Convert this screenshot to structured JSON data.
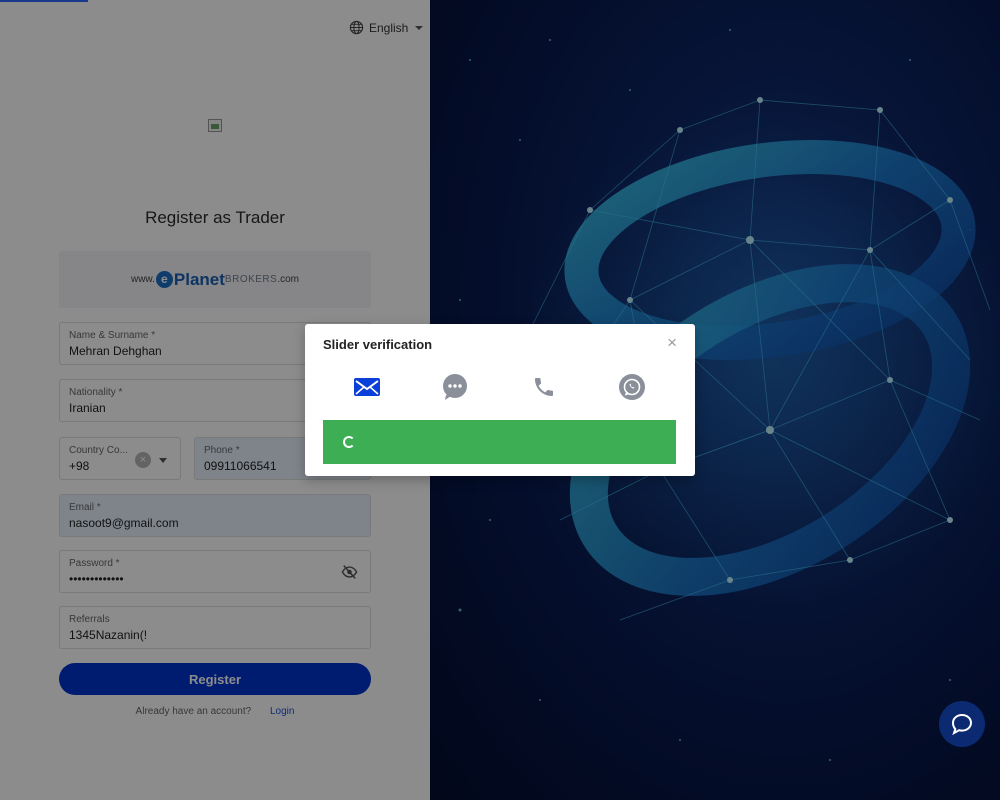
{
  "header": {
    "language": "English"
  },
  "page": {
    "title": "Register as Trader"
  },
  "brand": {
    "www": "www.",
    "letter": "e",
    "name": "Planet",
    "suffix": "BROKERS",
    "tld": ".com"
  },
  "form": {
    "name": {
      "label": "Name & Surname *",
      "value": "Mehran Dehghan"
    },
    "nationality": {
      "label": "Nationality *",
      "value": "Iranian"
    },
    "country_code": {
      "label": "Country Co...",
      "value": "+98"
    },
    "phone": {
      "label": "Phone *",
      "value": "09911066541"
    },
    "email": {
      "label": "Email *",
      "value": "nasoot9@gmail.com"
    },
    "password": {
      "label": "Password *",
      "value": "•••••••••••••"
    },
    "referrals": {
      "label": "Referrals",
      "value": "1345Nazanin(!"
    },
    "register_label": "Register",
    "login_prompt": "Already have an account?",
    "login_label": "Login"
  },
  "modal": {
    "title": "Slider verification",
    "close": "×",
    "methods": [
      {
        "icon": "email-icon",
        "color": "#0a3fd9"
      },
      {
        "icon": "sms-chat-icon",
        "color": "#8a8f99"
      },
      {
        "icon": "phone-icon",
        "color": "#8a8f99"
      },
      {
        "icon": "whatsapp-icon",
        "color": "#8a8f99"
      }
    ],
    "slider_color": "#3eae55"
  },
  "colors": {
    "primary": "#0033cc",
    "link": "#1b52d8",
    "overlay": "rgba(0,0,0,0.45)"
  }
}
